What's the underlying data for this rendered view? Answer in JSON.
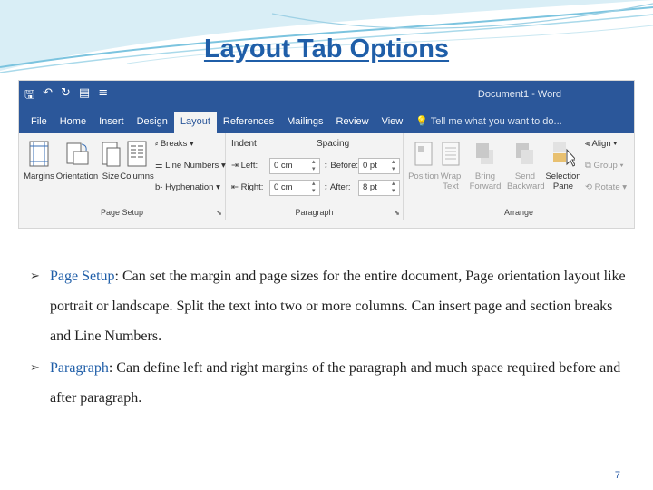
{
  "slide": {
    "title": "Layout Tab Options",
    "page_number": "7"
  },
  "ribbon": {
    "doc_title": "Document1 - Word",
    "quick_access": [
      "save-icon",
      "undo-icon",
      "redo-icon",
      "print-preview-icon",
      "customize-icon"
    ],
    "tabs": [
      "File",
      "Home",
      "Insert",
      "Design",
      "Layout",
      "References",
      "Mailings",
      "Review",
      "View"
    ],
    "active_tab": "Layout",
    "tell_me": "Tell me what you want to do...",
    "page_setup": {
      "label": "Page Setup",
      "margins": "Margins",
      "orientation": "Orientation",
      "size": "Size",
      "columns": "Columns",
      "breaks": "Breaks",
      "line_numbers": "Line Numbers",
      "hyphenation": "Hyphenation"
    },
    "paragraph": {
      "label": "Paragraph",
      "indent": "Indent",
      "spacing": "Spacing",
      "left_label": "Left:",
      "right_label": "Right:",
      "before_label": "Before:",
      "after_label": "After:",
      "left_value": "0 cm",
      "right_value": "0 cm",
      "before_value": "0 pt",
      "after_value": "8 pt"
    },
    "arrange": {
      "label": "Arrange",
      "position": "Position",
      "wrap_text_1": "Wrap",
      "wrap_text_2": "Text",
      "bring_forward_1": "Bring",
      "bring_forward_2": "Forward",
      "send_backward_1": "Send",
      "send_backward_2": "Backward",
      "selection_pane_1": "Selection",
      "selection_pane_2": "Pane",
      "align": "Align",
      "group": "Group",
      "rotate": "Rotate"
    }
  },
  "bullets": [
    {
      "term": "Page Setup",
      "text": ": Can set the margin and page sizes for the entire document, Page orientation layout like portrait or landscape. Split the text into two or more columns. Can insert page and section breaks and Line Numbers."
    },
    {
      "term": "Paragraph",
      "text": ": Can define left and right margins of the paragraph and much space required before and after paragraph."
    }
  ],
  "colors": {
    "title": "#1f5ea8",
    "ribbon_blue": "#2b579a",
    "term": "#1f5ea8"
  }
}
